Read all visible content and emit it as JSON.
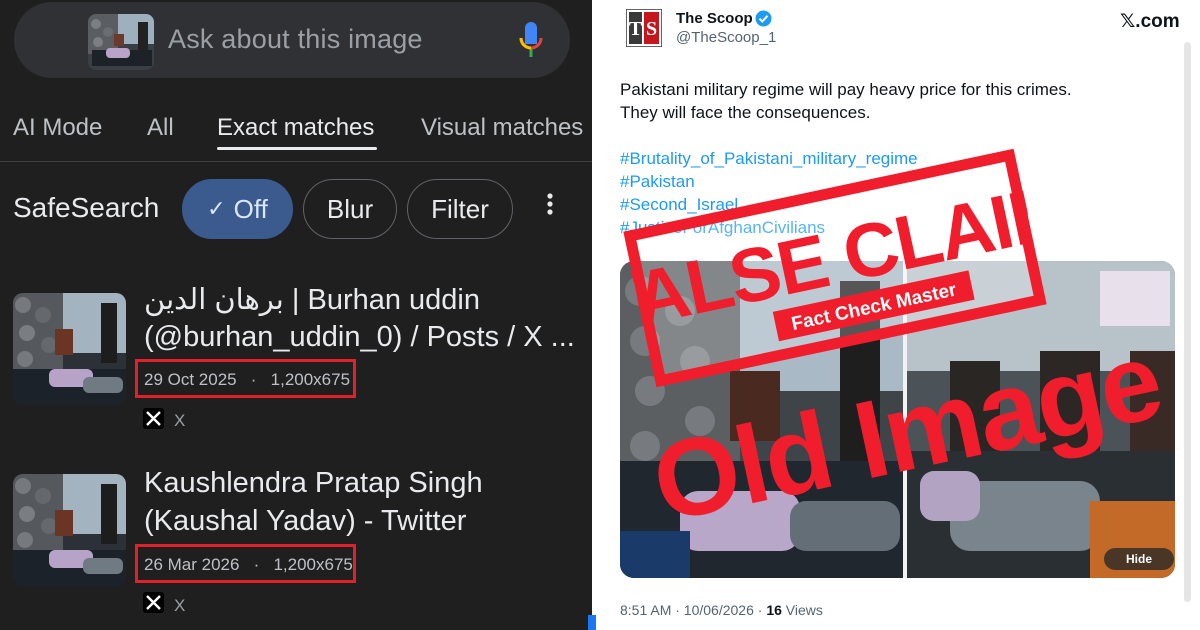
{
  "search": {
    "placeholder": "Ask about this image"
  },
  "tabs": [
    {
      "label": "AI Mode"
    },
    {
      "label": "All"
    },
    {
      "label": "Exact matches",
      "active": true
    },
    {
      "label": "Visual matches"
    }
  ],
  "safesearch": {
    "label": "SafeSearch",
    "chips": [
      {
        "label": "Off",
        "selected": true,
        "icon": "check-icon"
      },
      {
        "label": "Blur"
      },
      {
        "label": "Filter"
      }
    ],
    "more_icon": "more-vert-icon"
  },
  "results": [
    {
      "title_line1": "برهان الدين | Burhan uddin",
      "title_line2": "(@burhan_uddin_0) / Posts / X ...",
      "date": "29 Oct 2025",
      "sep": "·",
      "dimensions": "1,200x675",
      "source": "X"
    },
    {
      "title_line1": "Kaushlendra Pratap Singh",
      "title_line2": "(Kaushal Yadav) - Twitter",
      "date": "26 Mar 2026",
      "sep": "·",
      "dimensions": "1,200x675",
      "source": "X"
    }
  ],
  "post": {
    "name": "The Scoop",
    "handle": "@TheScoop_1",
    "avatar_text": "TS",
    "site": "𝕏.com",
    "text_line1": "Pakistani military regime will pay heavy price for this crimes.",
    "text_line2": "They will face the consequences.",
    "hashtags": [
      "#Brutality_of_Pakistani_military_regime",
      "#Pakistan",
      "#Second_Israel",
      "#JusticeForAfghanCivilians"
    ],
    "hide_label": "Hide",
    "time": "8:51 AM · 10/06/2026 ·",
    "views_count": "16",
    "views_label": "Views"
  },
  "overlay": {
    "false_claim": "FALSE CLAIM",
    "fact_check": "Fact Check Master",
    "old_image": "Old Image"
  },
  "colors": {
    "dark_bg": "#1f1f1f",
    "accent_red": "#e0202a",
    "stamp_red": "#f01e2c",
    "link_blue": "#1d9bf0",
    "chip_selected": "#3b5b8f"
  }
}
